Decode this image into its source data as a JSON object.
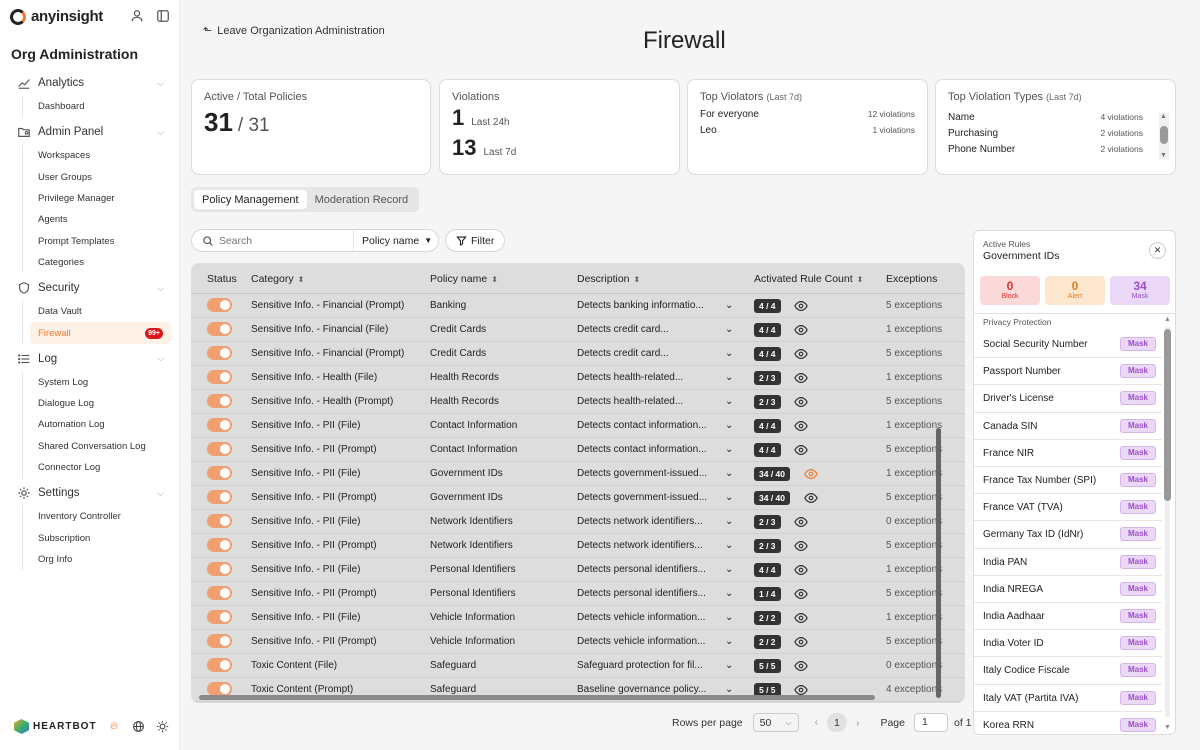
{
  "brand": {
    "name": "anyinsight"
  },
  "sidebar": {
    "title": "Org Administration",
    "sections": [
      {
        "label": "Analytics",
        "icon": "chart-line-icon",
        "items": [
          "Dashboard"
        ]
      },
      {
        "label": "Admin Panel",
        "icon": "folder-user-icon",
        "items": [
          "Workspaces",
          "User Groups",
          "Privilege Manager",
          "Agents",
          "Prompt Templates",
          "Categories"
        ]
      },
      {
        "label": "Security",
        "icon": "shield-icon",
        "items": [
          "Data Vault",
          "Firewall"
        ]
      },
      {
        "label": "Log",
        "icon": "list-icon",
        "items": [
          "System Log",
          "Dialogue Log",
          "Automation Log",
          "Shared Conversation Log",
          "Connector Log"
        ]
      },
      {
        "label": "Settings",
        "icon": "gear-icon",
        "items": [
          "Inventory Controller",
          "Subscription",
          "Org Info"
        ]
      }
    ],
    "active_item": "Firewall",
    "firewall_badge": "99+",
    "footer_brand": "HEARTBOT"
  },
  "header": {
    "back_link": "Leave Organization Administration",
    "title": "Firewall"
  },
  "cards": {
    "policies": {
      "title": "Active / Total Policies",
      "active": "31",
      "total": "/ 31"
    },
    "violations": {
      "title": "Violations",
      "v24": "1",
      "l24": "Last 24h",
      "v7": "13",
      "l7": "Last 7d"
    },
    "violators": {
      "title": "Top Violators",
      "period": "(Last 7d)",
      "rows": [
        {
          "name": "For everyone",
          "count": "12 violations"
        },
        {
          "name": "Leo",
          "count": "1 violations"
        }
      ]
    },
    "types": {
      "title": "Top Violation Types",
      "period": "(Last 7d)",
      "rows": [
        {
          "name": "Name",
          "count": "4 violations"
        },
        {
          "name": "Purchasing",
          "count": "2 violations"
        },
        {
          "name": "Phone Number",
          "count": "2 violations"
        }
      ]
    }
  },
  "tabs": [
    "Policy Management",
    "Moderation Record"
  ],
  "search": {
    "placeholder": "Search",
    "field": "Policy name",
    "filter": "Filter"
  },
  "table": {
    "headers": {
      "status": "Status",
      "category": "Category",
      "policy": "Policy name",
      "description": "Description",
      "count": "Activated Rule Count",
      "exceptions": "Exceptions"
    },
    "rows": [
      {
        "category": "Sensitive Info. - Financial (Prompt)",
        "policy": "Banking",
        "desc": "Detects banking informatio...",
        "count": "4 / 4",
        "exc": "5 exceptions",
        "warn": false
      },
      {
        "category": "Sensitive Info. - Financial (File)",
        "policy": "Credit Cards",
        "desc": "Detects credit card...",
        "count": "4 / 4",
        "exc": "1 exceptions",
        "warn": false
      },
      {
        "category": "Sensitive Info. - Financial (Prompt)",
        "policy": "Credit Cards",
        "desc": "Detects credit card...",
        "count": "4 / 4",
        "exc": "5 exceptions",
        "warn": false
      },
      {
        "category": "Sensitive Info. - Health (File)",
        "policy": "Health Records",
        "desc": "Detects health-related...",
        "count": "2 / 3",
        "exc": "1 exceptions",
        "warn": false
      },
      {
        "category": "Sensitive Info. - Health (Prompt)",
        "policy": "Health Records",
        "desc": "Detects health-related...",
        "count": "2 / 3",
        "exc": "5 exceptions",
        "warn": false
      },
      {
        "category": "Sensitive Info. - PII (File)",
        "policy": "Contact Information",
        "desc": "Detects contact information...",
        "count": "4 / 4",
        "exc": "1 exceptions",
        "warn": false
      },
      {
        "category": "Sensitive Info. - PII (Prompt)",
        "policy": "Contact Information",
        "desc": "Detects contact information...",
        "count": "4 / 4",
        "exc": "5 exceptions",
        "warn": false
      },
      {
        "category": "Sensitive Info. - PII (File)",
        "policy": "Government IDs",
        "desc": "Detects government-issued...",
        "count": "34 / 40",
        "exc": "1 exceptions",
        "warn": true
      },
      {
        "category": "Sensitive Info. - PII (Prompt)",
        "policy": "Government IDs",
        "desc": "Detects government-issued...",
        "count": "34 / 40",
        "exc": "5 exceptions",
        "warn": false
      },
      {
        "category": "Sensitive Info. - PII (File)",
        "policy": "Network Identifiers",
        "desc": "Detects network identifiers...",
        "count": "2 / 3",
        "exc": "0 exceptions",
        "warn": false
      },
      {
        "category": "Sensitive Info. - PII (Prompt)",
        "policy": "Network Identifiers",
        "desc": "Detects network identifiers...",
        "count": "2 / 3",
        "exc": "5 exceptions",
        "warn": false
      },
      {
        "category": "Sensitive Info. - PII (File)",
        "policy": "Personal Identifiers",
        "desc": "Detects personal identifiers...",
        "count": "4 / 4",
        "exc": "1 exceptions",
        "warn": false
      },
      {
        "category": "Sensitive Info. - PII (Prompt)",
        "policy": "Personal Identifiers",
        "desc": "Detects personal identifiers...",
        "count": "1 / 4",
        "exc": "5 exceptions",
        "warn": false
      },
      {
        "category": "Sensitive Info. - PII (File)",
        "policy": "Vehicle Information",
        "desc": "Detects vehicle information...",
        "count": "2 / 2",
        "exc": "1 exceptions",
        "warn": false
      },
      {
        "category": "Sensitive Info. - PII (Prompt)",
        "policy": "Vehicle Information",
        "desc": "Detects vehicle information...",
        "count": "2 / 2",
        "exc": "5 exceptions",
        "warn": false
      },
      {
        "category": "Toxic Content (File)",
        "policy": "Safeguard",
        "desc": "Safeguard protection for fil...",
        "count": "5 / 5",
        "exc": "0 exceptions",
        "warn": false
      },
      {
        "category": "Toxic Content (Prompt)",
        "policy": "Safeguard",
        "desc": "Baseline governance policy...",
        "count": "5 / 5",
        "exc": "4 exceptions",
        "warn": false
      }
    ]
  },
  "pagination": {
    "rows_label": "Rows per page",
    "rows_value": "50",
    "current": "1",
    "page_label": "Page",
    "page_value": "1",
    "of": "of 1"
  },
  "panel": {
    "title": "Active Rules",
    "subtitle": "Government IDs",
    "stats": [
      {
        "n": "0",
        "l": "Block"
      },
      {
        "n": "0",
        "l": "Alert"
      },
      {
        "n": "34",
        "l": "Mask"
      }
    ],
    "group": "Privacy Protection",
    "mask_label": "Mask",
    "rules": [
      "Social Security Number",
      "Passport Number",
      "Driver's License",
      "Canada SIN",
      "France NIR",
      "France Tax Number (SPI)",
      "France VAT (TVA)",
      "Germany Tax ID (IdNr)",
      "India PAN",
      "India NREGA",
      "India Aadhaar",
      "India Voter ID",
      "Italy Codice Fiscale",
      "Italy VAT (Partita IVA)",
      "Korea RRN"
    ]
  }
}
